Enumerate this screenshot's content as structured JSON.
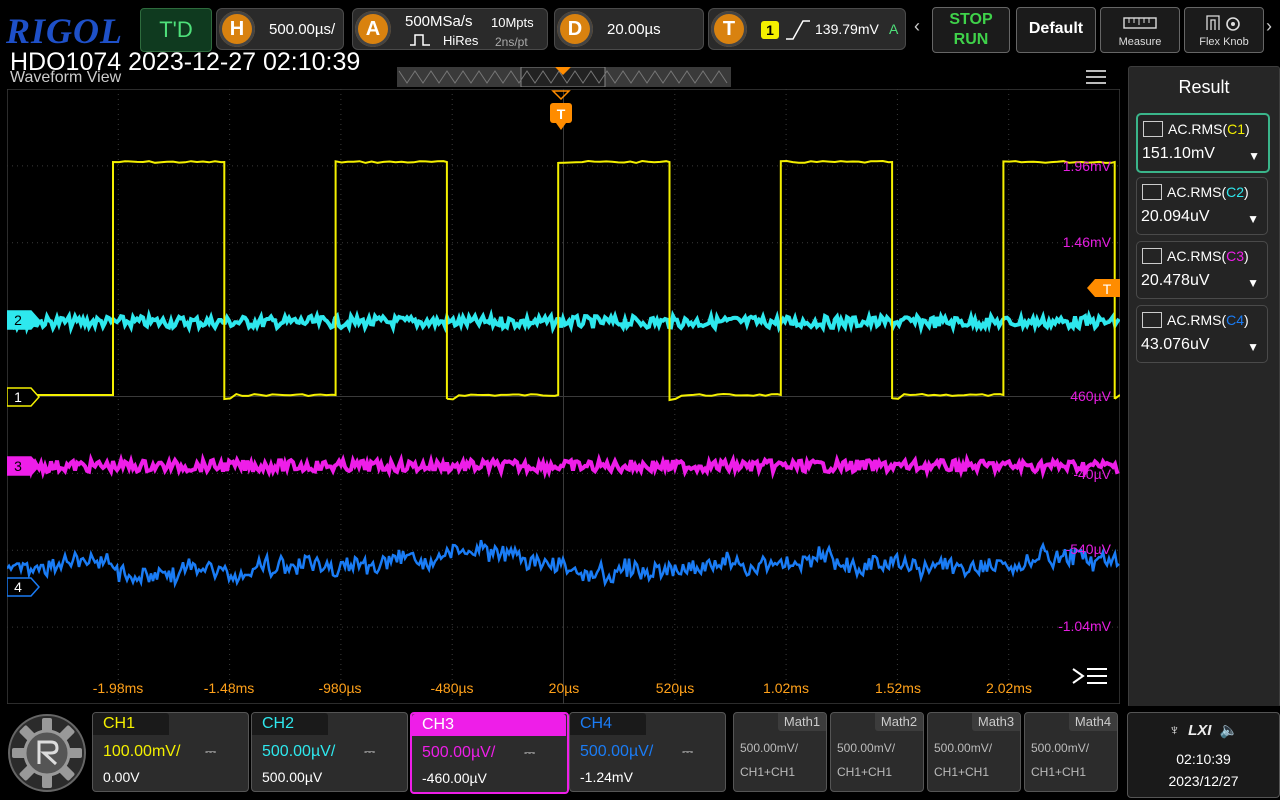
{
  "top": {
    "brand": "RIGOL",
    "mode": "T'D",
    "h_icon": "H",
    "h_timebase": "500.00µs/",
    "a_icon": "A",
    "sample_rate": "500MSa/s",
    "acq_mode": "HiRes",
    "mem_depth": "10Mpts",
    "sample_period": "2ns/pt",
    "d_icon": "D",
    "delay": "20.00µs",
    "t_icon": "T",
    "trig_source": "1",
    "trig_level": "139.79mV",
    "trig_status": "A",
    "stop_label": "STOP",
    "run_label": "RUN",
    "default_label": "Default",
    "measure_label": "Measure",
    "flexknob_label": "Flex Knob"
  },
  "header": {
    "model_datetime": "HDO1074 2023-12-27 02:10:39",
    "view_title": "Waveform View"
  },
  "waveform": {
    "trigger_marker": "T",
    "right_trigger_marker": "T",
    "ch_markers": [
      "2",
      "1",
      "3",
      "4"
    ],
    "volt_labels": [
      "1.96mV",
      "1.46mV",
      "460µV",
      "-40µV",
      "-540µV",
      "-1.04mV"
    ],
    "time_labels": [
      "-1.98ms",
      "-1.48ms",
      "-980µs",
      "-480µs",
      "20µs",
      "520µs",
      "1.02ms",
      "1.52ms",
      "2.02ms"
    ],
    "colors": {
      "ch1": "#f4f000",
      "ch2": "#2ee8ee",
      "ch3": "#ee1ee8",
      "ch4": "#1a7cf5",
      "grid": "#3a3a3a",
      "axis_label": "#ffa11a",
      "volt_label": "#e51ee0"
    }
  },
  "result": {
    "title": "Result",
    "items": [
      {
        "name": "AC.RMS(",
        "src": "C1",
        "close": ")",
        "value": "151.10mV",
        "src_color": "#f4f000"
      },
      {
        "name": "AC.RMS(",
        "src": "C2",
        "close": ")",
        "value": "20.094uV",
        "src_color": "#2ee8ee"
      },
      {
        "name": "AC.RMS(",
        "src": "C3",
        "close": ")",
        "value": "20.478uV",
        "src_color": "#ee1ee8"
      },
      {
        "name": "AC.RMS(",
        "src": "C4",
        "close": ")",
        "value": "43.076uV",
        "src_color": "#1a7cf5"
      }
    ]
  },
  "channels": [
    {
      "label": "CH1",
      "scale": "100.00mV/",
      "offset": "0.00V",
      "color": "#f4f000"
    },
    {
      "label": "CH2",
      "scale": "500.00µV/",
      "offset": "500.00µV",
      "color": "#2ee8ee"
    },
    {
      "label": "CH3",
      "scale": "500.00µV/",
      "offset": "-460.00µV",
      "color": "#ee1ee8"
    },
    {
      "label": "CH4",
      "scale": "500.00µV/",
      "offset": "-1.24mV",
      "color": "#1a7cf5"
    }
  ],
  "maths": [
    {
      "label": "Math1",
      "scale": "500.00mV/",
      "source": "CH1+CH1"
    },
    {
      "label": "Math2",
      "scale": "500.00mV/",
      "source": "CH1+CH1"
    },
    {
      "label": "Math3",
      "scale": "500.00mV/",
      "source": "CH1+CH1"
    },
    {
      "label": "Math4",
      "scale": "500.00mV/",
      "source": "CH1+CH1"
    }
  ],
  "status": {
    "time": "02:10:39",
    "date": "2023/12/27",
    "lxi": "LXI"
  }
}
